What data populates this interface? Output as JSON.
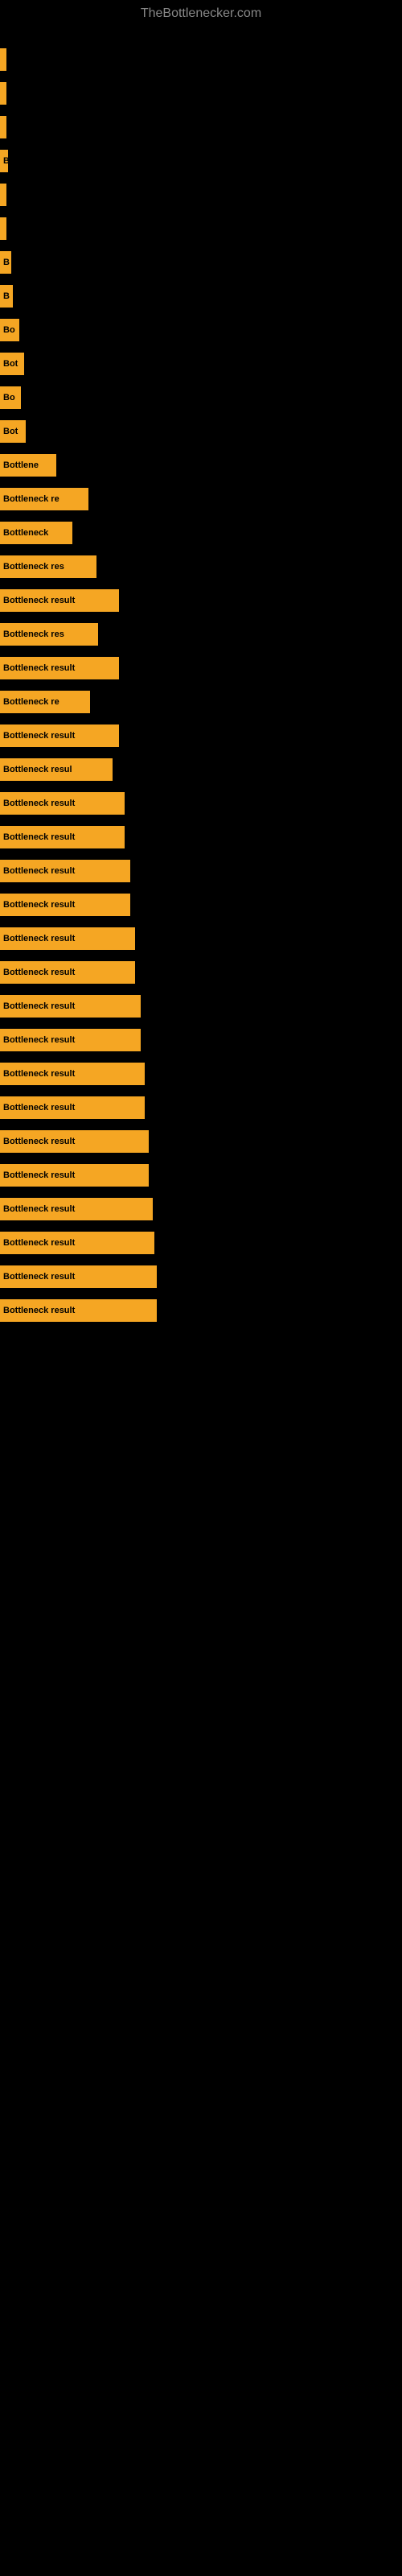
{
  "site": {
    "title": "TheBottlenecker.com"
  },
  "bars": [
    {
      "label": "",
      "width": 8
    },
    {
      "label": "",
      "width": 8
    },
    {
      "label": "",
      "width": 8
    },
    {
      "label": "B",
      "width": 10
    },
    {
      "label": "",
      "width": 8
    },
    {
      "label": "",
      "width": 8
    },
    {
      "label": "B",
      "width": 14
    },
    {
      "label": "B",
      "width": 16
    },
    {
      "label": "Bo",
      "width": 24
    },
    {
      "label": "Bot",
      "width": 30
    },
    {
      "label": "Bo",
      "width": 26
    },
    {
      "label": "Bot",
      "width": 32
    },
    {
      "label": "Bottlene",
      "width": 70
    },
    {
      "label": "Bottleneck re",
      "width": 110
    },
    {
      "label": "Bottleneck",
      "width": 90
    },
    {
      "label": "Bottleneck res",
      "width": 120
    },
    {
      "label": "Bottleneck result",
      "width": 148
    },
    {
      "label": "Bottleneck res",
      "width": 122
    },
    {
      "label": "Bottleneck result",
      "width": 148
    },
    {
      "label": "Bottleneck re",
      "width": 112
    },
    {
      "label": "Bottleneck result",
      "width": 148
    },
    {
      "label": "Bottleneck resul",
      "width": 140
    },
    {
      "label": "Bottleneck result",
      "width": 155
    },
    {
      "label": "Bottleneck result",
      "width": 155
    },
    {
      "label": "Bottleneck result",
      "width": 162
    },
    {
      "label": "Bottleneck result",
      "width": 162
    },
    {
      "label": "Bottleneck result",
      "width": 168
    },
    {
      "label": "Bottleneck result",
      "width": 168
    },
    {
      "label": "Bottleneck result",
      "width": 175
    },
    {
      "label": "Bottleneck result",
      "width": 175
    },
    {
      "label": "Bottleneck result",
      "width": 180
    },
    {
      "label": "Bottleneck result",
      "width": 180
    },
    {
      "label": "Bottleneck result",
      "width": 185
    },
    {
      "label": "Bottleneck result",
      "width": 185
    },
    {
      "label": "Bottleneck result",
      "width": 190
    },
    {
      "label": "Bottleneck result",
      "width": 192
    },
    {
      "label": "Bottleneck result",
      "width": 195
    },
    {
      "label": "Bottleneck result",
      "width": 195
    }
  ]
}
